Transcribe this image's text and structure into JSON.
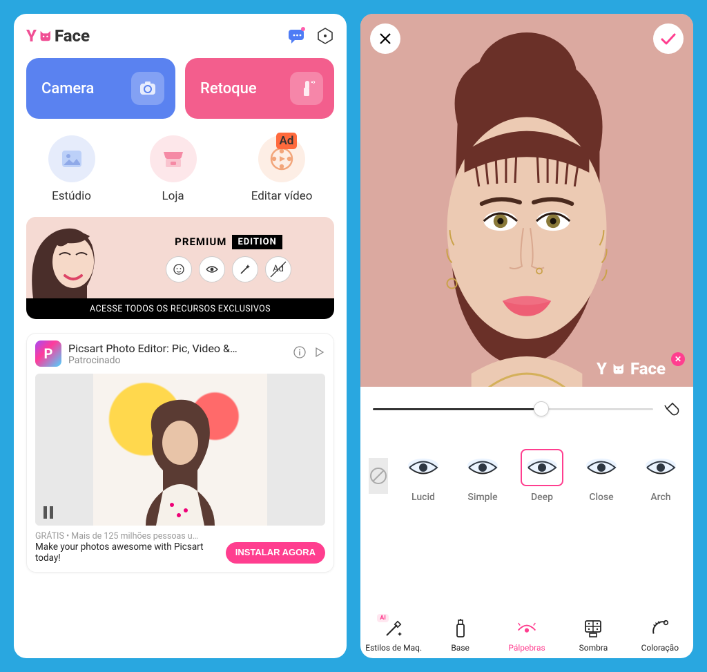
{
  "app": {
    "name_y": "Y",
    "name_face": "Face"
  },
  "left": {
    "main_buttons": {
      "camera": "Camera",
      "retoque": "Retoque"
    },
    "icon_row": {
      "estudio": "Estúdio",
      "loja": "Loja",
      "editar_video": "Editar vídeo",
      "ad_badge": "Ad"
    },
    "premium": {
      "pre": "PREMIUM",
      "edition": "EDITION",
      "cta": "ACESSE TODOS OS RECURSOS EXCLUSIVOS",
      "icons": [
        "face",
        "eye",
        "wand",
        "ad"
      ],
      "ad_text": "Ad"
    },
    "ad": {
      "logo_letter": "P",
      "title": "Picsart Photo Editor: Pic, Video &…",
      "subtitle": "Patrocinado",
      "gratis_line": "GRÁTIS • Mais de 125 milhões pessoas u…",
      "desc": "Make your photos awesome with Picsart today!",
      "install": "INSTALAR AGORA"
    }
  },
  "right": {
    "watermark_y": "Y",
    "watermark_face": "Face",
    "styles": {
      "items": [
        {
          "label": "Lucid"
        },
        {
          "label": "Simple"
        },
        {
          "label": "Deep",
          "selected": true
        },
        {
          "label": "Close"
        },
        {
          "label": "Arch"
        }
      ]
    },
    "tabs": {
      "items": [
        {
          "label": "Estilos de Maq.",
          "ai": "AI"
        },
        {
          "label": "Base"
        },
        {
          "label": "Pálpebras",
          "active": true
        },
        {
          "label": "Sombra"
        },
        {
          "label": "Coloração"
        }
      ]
    }
  }
}
